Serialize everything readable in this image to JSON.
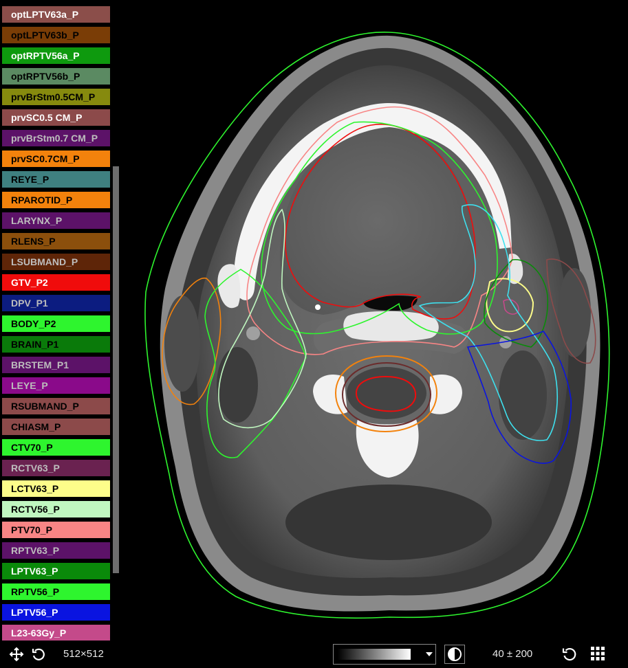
{
  "structures": [
    {
      "label": "optLPTV63a_P",
      "color": "#8b4e4a",
      "text_color": "#ffffff"
    },
    {
      "label": "optLPTV63b_P",
      "color": "#7a3d06",
      "text_color": "#000000"
    },
    {
      "label": "optRPTV56a_P",
      "color": "#0e9a0e",
      "text_color": "#ffffff"
    },
    {
      "label": "optRPTV56b_P",
      "color": "#5b8a62",
      "text_color": "#000000"
    },
    {
      "label": "prvBrStm0.5CM_P",
      "color": "#868a0e",
      "text_color": "#000000"
    },
    {
      "label": "prvSC0.5 CM_P",
      "color": "#8c4a4a",
      "text_color": "#ffffff"
    },
    {
      "label": "prvBrStm0.7 CM_P",
      "color": "#5c1268",
      "text_color": "#bdbdbd"
    },
    {
      "label": "prvSC0.7CM_P",
      "color": "#f3820c",
      "text_color": "#000000"
    },
    {
      "label": "REYE_P",
      "color": "#3f8080",
      "text_color": "#000000"
    },
    {
      "label": "RPAROTID_P",
      "color": "#f3820c",
      "text_color": "#000000"
    },
    {
      "label": "LARYNX_P",
      "color": "#5c1268",
      "text_color": "#bdbdbd"
    },
    {
      "label": "RLENS_P",
      "color": "#8b4f0c",
      "text_color": "#000000"
    },
    {
      "label": "LSUBMAND_P",
      "color": "#5e2508",
      "text_color": "#bdbdbd"
    },
    {
      "label": "GTV_P2",
      "color": "#f00c0c",
      "text_color": "#ffffff"
    },
    {
      "label": "DPV_P1",
      "color": "#0c1c80",
      "text_color": "#bdbdbd"
    },
    {
      "label": "BODY_P2",
      "color": "#2ef52e",
      "text_color": "#000000"
    },
    {
      "label": "BRAIN_P1",
      "color": "#0a7a0a",
      "text_color": "#000000"
    },
    {
      "label": "BRSTEM_P1",
      "color": "#5c1268",
      "text_color": "#bdbdbd"
    },
    {
      "label": "LEYE_P",
      "color": "#8a0a8a",
      "text_color": "#bdbdbd"
    },
    {
      "label": "RSUBMAND_P",
      "color": "#8c4a4a",
      "text_color": "#000000"
    },
    {
      "label": "CHIASM_P",
      "color": "#8c4a4a",
      "text_color": "#000000"
    },
    {
      "label": "CTV70_P",
      "color": "#2ef52e",
      "text_color": "#000000"
    },
    {
      "label": "RCTV63_P",
      "color": "#6a2250",
      "text_color": "#bdbdbd"
    },
    {
      "label": "LCTV63_P",
      "color": "#fdfd8a",
      "text_color": "#000000"
    },
    {
      "label": "RCTV56_P",
      "color": "#c0f7c0",
      "text_color": "#000000"
    },
    {
      "label": "PTV70_P",
      "color": "#f88585",
      "text_color": "#000000"
    },
    {
      "label": "RPTV63_P",
      "color": "#5c1268",
      "text_color": "#bdbdbd"
    },
    {
      "label": "LPTV63_P",
      "color": "#0a8a0a",
      "text_color": "#ffffff"
    },
    {
      "label": "RPTV56_P",
      "color": "#2ef52e",
      "text_color": "#000000"
    },
    {
      "label": "LPTV56_P",
      "color": "#0a14e0",
      "text_color": "#ffffff"
    },
    {
      "label": "L23-63Gy_P",
      "color": "#c44a8a",
      "text_color": "#ffffff"
    }
  ],
  "toolbar": {
    "pan_icon": "move-arrows-icon",
    "rotate_icon": "rotate-ccw-icon",
    "matrix_size": "512×512",
    "lut_icon": "chevron-down-icon",
    "contrast_icon": "contrast-icon",
    "window_level": "40 ± 200",
    "reset_icon": "reset-icon",
    "layout_icon": "grid-icon"
  }
}
